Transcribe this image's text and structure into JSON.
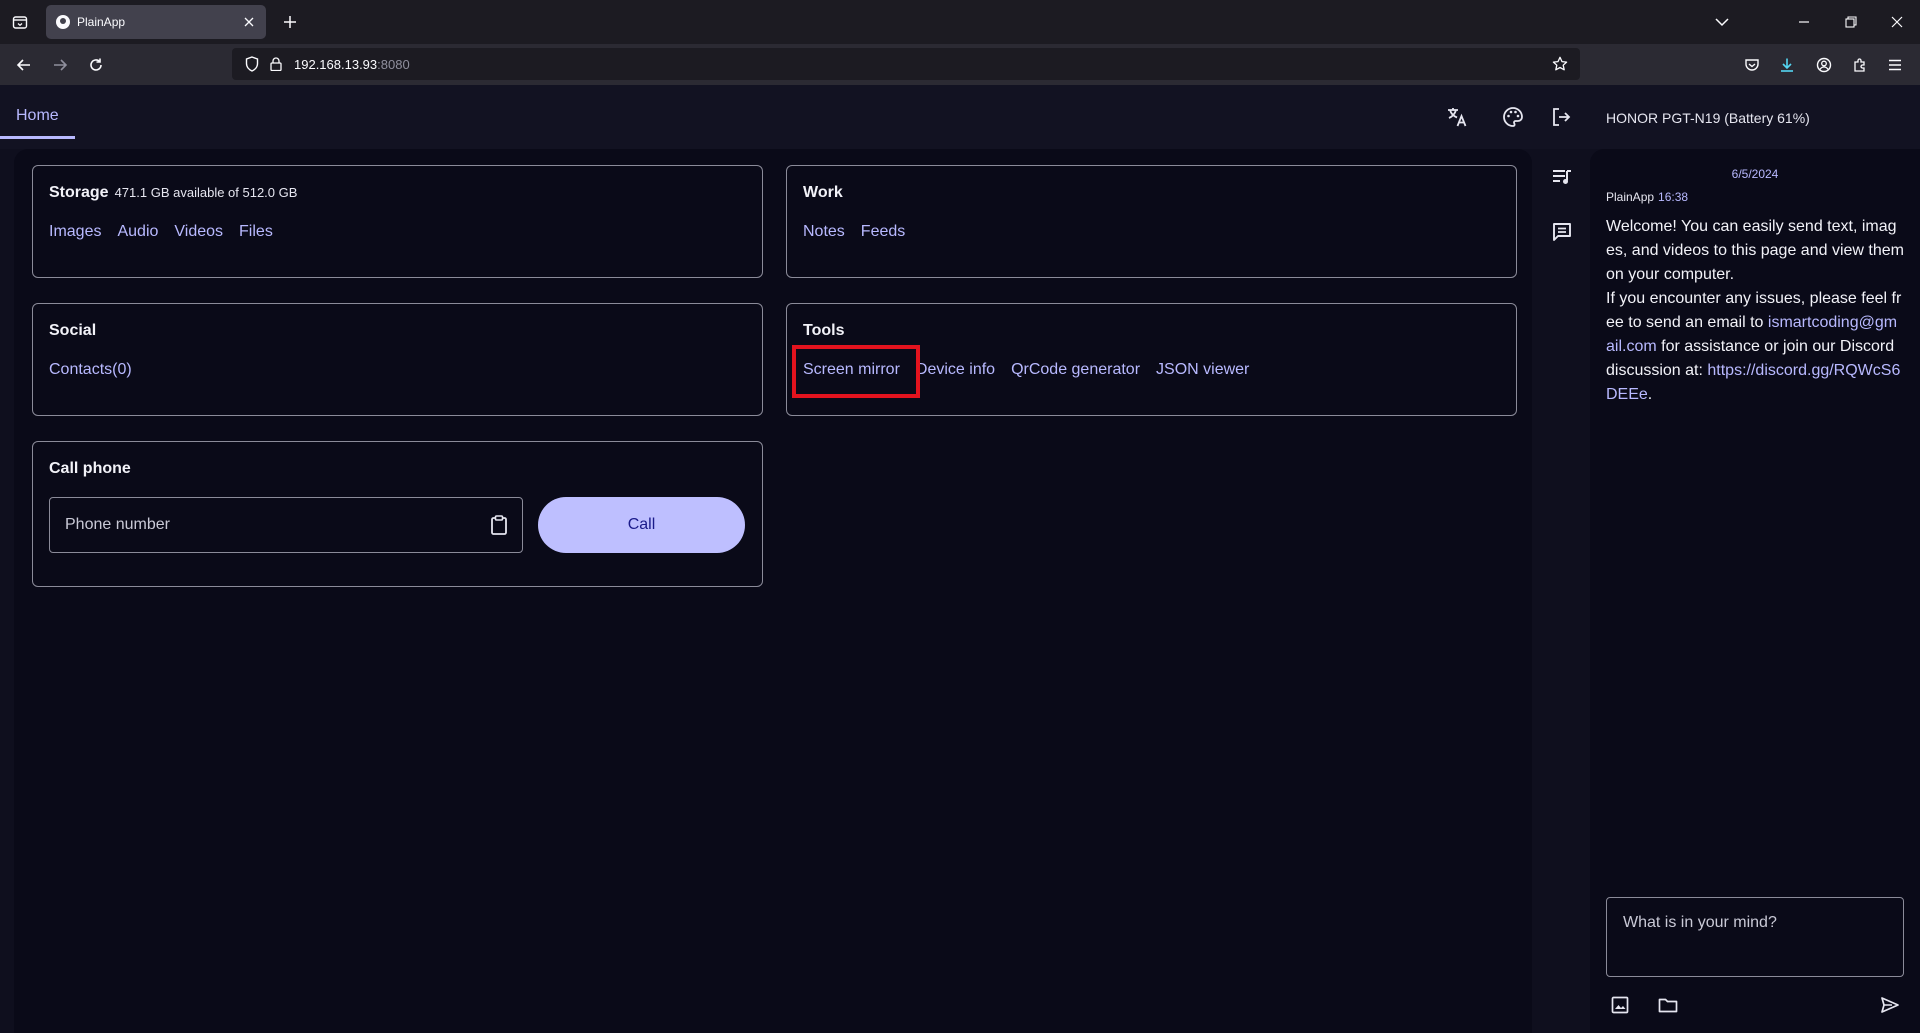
{
  "browser": {
    "tab_title": "PlainApp",
    "url_host": "192.168.13.93",
    "url_port": ":8080"
  },
  "header": {
    "home_tab": "Home",
    "device_name": "HONOR PGT-N19 (Battery 61%)"
  },
  "storage": {
    "title": "Storage",
    "subtitle": "471.1 GB available of 512.0 GB",
    "links": [
      "Images",
      "Audio",
      "Videos",
      "Files"
    ]
  },
  "work": {
    "title": "Work",
    "links": [
      "Notes",
      "Feeds"
    ]
  },
  "social": {
    "title": "Social",
    "links": [
      "Contacts(0)"
    ]
  },
  "tools": {
    "title": "Tools",
    "links": [
      "Screen mirror",
      "Device info",
      "QrCode generator",
      "JSON viewer"
    ]
  },
  "call_phone": {
    "title": "Call phone",
    "placeholder": "Phone number",
    "button": "Call"
  },
  "chat": {
    "date": "6/5/2024",
    "sender": "PlainApp",
    "time": "16:38",
    "message_part1": "Welcome! You can easily send text, images, and videos to this page and view them on your computer.",
    "message_part2": "If you encounter any issues, please feel free to send an email to ",
    "email": "ismartcoding@gmail.com",
    "message_part3": " for assistance or join our Discord discussion at: ",
    "discord_link": "https://discord.gg/RQWcS6DEEe",
    "message_end": ".",
    "input_placeholder": "What is in your mind?"
  },
  "colors": {
    "accent": "#b8b9ff",
    "background": "#0a0a18",
    "highlight": "#e3131e",
    "call_button": "#bebfff"
  }
}
